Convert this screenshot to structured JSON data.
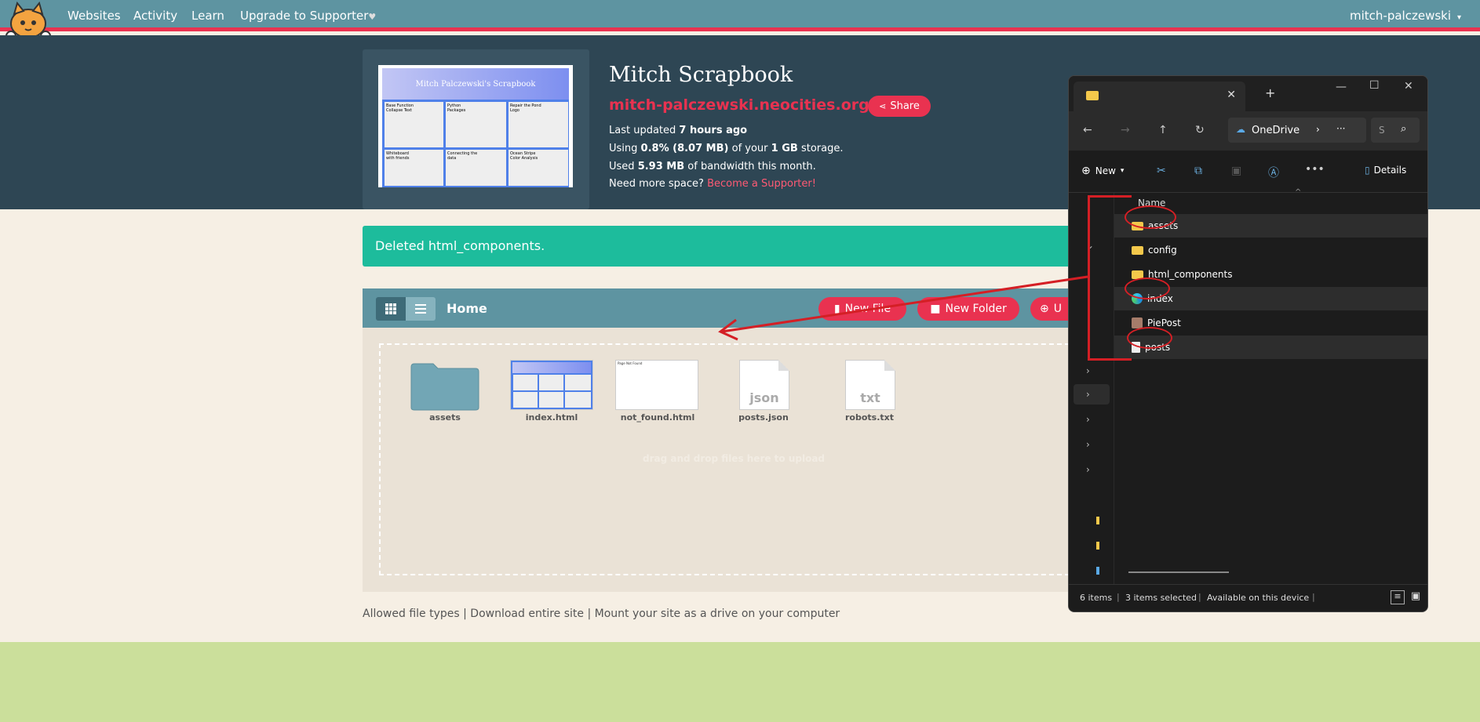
{
  "nav": {
    "links": [
      "Websites",
      "Activity",
      "Learn",
      "Upgrade to Supporter"
    ],
    "supporter_heart": "♥",
    "user": "mitch-palczewski"
  },
  "site": {
    "title": "Mitch Scrapbook",
    "url": "mitch-palczewski.neocities.org",
    "share_label": "Share",
    "updated_label": "Last updated",
    "updated_value": "7 hours ago",
    "using_label": "Using",
    "using_value": "0.8% (8.07 MB)",
    "of_label": "of your",
    "storage_value": "1 GB",
    "storage_suffix": "storage.",
    "used_label": "Used",
    "bandwidth_value": "5.93 MB",
    "bandwidth_suffix": "of bandwidth this month.",
    "need_space": "Need more space?",
    "become_supporter": "Become a Supporter!"
  },
  "thumbnail": {
    "heading": "Mitch Palczewski's Scrapbook",
    "cards": [
      "Base Function\nCollapse Text",
      "Python\nPackages",
      "Repair the Pond\nLogo",
      "Whiteboard\nwith friends",
      "Connecting the\ndata",
      "Ocean Stripe\nColor Analysis"
    ]
  },
  "alert": {
    "text": "Deleted html_components."
  },
  "file_manager": {
    "home_label": "Home",
    "new_file": "New File",
    "new_folder": "New Folder",
    "upload": "U",
    "files": [
      {
        "name": "assets",
        "kind": "folder"
      },
      {
        "name": "index.html",
        "kind": "page-thumb"
      },
      {
        "name": "not_found.html",
        "kind": "blank-thumb",
        "thumb_text": "Page Not Found"
      },
      {
        "name": "posts.json",
        "kind": "doc",
        "ext": "json"
      },
      {
        "name": "robots.txt",
        "kind": "doc",
        "ext": "txt"
      }
    ],
    "dropzone_text": "drag and drop files here to upload"
  },
  "footer": {
    "links": [
      "Allowed file types",
      "Download entire site",
      "Mount your site as a drive on your computer"
    ],
    "separator": "|"
  },
  "explorer": {
    "location": "OneDrive",
    "new_label": "New",
    "details_label": "Details",
    "search_hint": "S",
    "column_name": "Name",
    "items": [
      {
        "name": "assets",
        "type": "folder",
        "selected": true
      },
      {
        "name": "config",
        "type": "folder",
        "selected": false
      },
      {
        "name": "html_components",
        "type": "folder",
        "selected": false
      },
      {
        "name": "index",
        "type": "edge",
        "selected": true
      },
      {
        "name": "PiePost",
        "type": "image",
        "selected": false
      },
      {
        "name": "posts",
        "type": "file",
        "selected": true
      }
    ],
    "status": {
      "count": "6 items",
      "selected": "3 items selected",
      "availability": "Available on this device"
    }
  },
  "colors": {
    "nav": "#5e94a1",
    "accent": "#e93250",
    "header": "#2e4654",
    "alert": "#1dbc9c",
    "footer_band": "#cbdf9b"
  }
}
